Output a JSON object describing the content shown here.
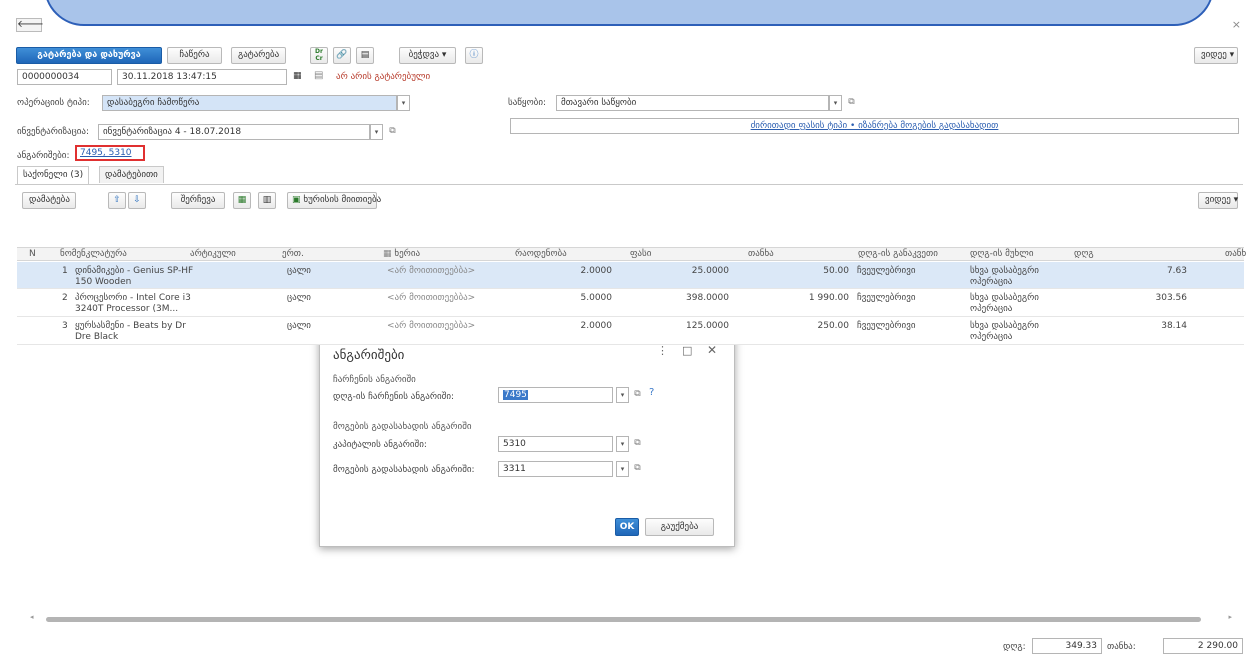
{
  "window": {
    "close_glyph": "×",
    "back_glyph": "🡐"
  },
  "toolbar": {
    "post_and_close": "გატარება და დახურვა",
    "save": "ჩაწერა",
    "post": "გატარება",
    "dr_cr": "Dr Cr",
    "print": "ბეჭდვა",
    "more": "ვიდეე"
  },
  "header": {
    "doc_number": "0000000034",
    "doc_date": "30.11.2018 13:47:15",
    "status": "არ არის გატარებული",
    "operation_type_label": "ოპერაციის ტიპი:",
    "operation_type_value": "დასაბეგრი ჩამოწერა",
    "inventory_label": "ინვენტარიზაცია:",
    "inventory_value": "ინვენტარიზაცია 4 - 18.07.2018",
    "warehouse_label": "საწყობი:",
    "warehouse_value": "მთავარი საწყობი",
    "link_text": "ძირითადი ფასის ტიპი • იზანრება მოგების გადასახადით",
    "accounts_label": "ანგარიშები:",
    "accounts_value": "7495, 5310"
  },
  "tabs": [
    {
      "label": "საქონელი (3)"
    },
    {
      "label": "დამატებითი"
    }
  ],
  "table_toolbar": {
    "add": "დამატება",
    "fill": "შერჩევა",
    "barcode": "ხურისის მიითიება",
    "more": "ვიდეე"
  },
  "table": {
    "columns": [
      "N",
      "ნომენკლატურა",
      "არტიკული",
      "ერთ.",
      "ხერია",
      "რაოდენობა",
      "ფასი",
      "თანხა",
      "დღგ-ის განაკვეთი",
      "დღგ-ის მუხლი",
      "დღგ",
      "თანხ"
    ],
    "rows": [
      {
        "n": "1",
        "name": "დინამიკები - Genius SP-HF 150 Wooden",
        "unit": "ცალი",
        "series": "<არ მოითითეებბა>",
        "qty": "2.0000",
        "price": "25.0000",
        "sum": "50.00",
        "vat_rate": "ჩვეულებრივი",
        "vat_item": "სხვა დასაბეგრი ოპერაცია",
        "vat": "7.63"
      },
      {
        "n": "2",
        "name": "პროცესორი - Intel Core i3 3240T Processor (3M...",
        "unit": "ცალი",
        "series": "<არ მოითითეებბა>",
        "qty": "5.0000",
        "price": "398.0000",
        "sum": "1 990.00",
        "vat_rate": "ჩვეულებრივი",
        "vat_item": "სხვა დასაბეგრი ოპერაცია",
        "vat": "303.56"
      },
      {
        "n": "3",
        "name": "ყურსასმენი - Beats by Dr Dre Black",
        "unit": "ცალი",
        "series": "<არ მოითითეებბა>",
        "qty": "2.0000",
        "price": "125.0000",
        "sum": "250.00",
        "vat_rate": "ჩვეულებრივი",
        "vat_item": "სხვა დასაბეგრი ოპერაცია",
        "vat": "38.14"
      }
    ]
  },
  "dialog": {
    "title": "ანგარიშები",
    "section_writeoff": "ჩარჩენის ანგარიში",
    "vat_writeoff_label": "დღგ-ის ჩარჩენის ანგარიში:",
    "vat_writeoff_value": "7495",
    "help": "?",
    "section_profit": "მოგების გადასახადის ანგარიში",
    "capital_label": "კაპიტალის ანგარიში:",
    "capital_value": "5310",
    "profit_tax_label": "მოგების გადასახადის ანგარიში:",
    "profit_tax_value": "3311",
    "ok": "OK",
    "cancel": "გაუქმება",
    "menu_glyph": "⋮",
    "max_glyph": "□",
    "close_glyph": "✕"
  },
  "footer": {
    "vat_label": "დღგ:",
    "vat_value": "349.33",
    "total_label": "თანხა:",
    "total_value": "2 290.00"
  }
}
